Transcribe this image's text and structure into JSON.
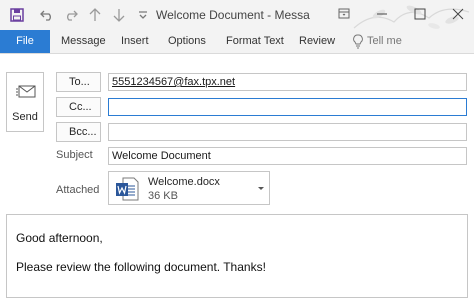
{
  "window": {
    "title": "Welcome Document  -  Messa"
  },
  "quick_access": {
    "icons": [
      "save-icon",
      "undo-icon",
      "redo-icon",
      "up-arrow-icon",
      "down-arrow-icon",
      "customize-icon"
    ]
  },
  "ribbon": {
    "tabs": [
      {
        "label": "File"
      },
      {
        "label": "Message"
      },
      {
        "label": "Insert"
      },
      {
        "label": "Options"
      },
      {
        "label": "Format Text"
      },
      {
        "label": "Review"
      }
    ],
    "tell_me": "Tell me"
  },
  "compose": {
    "send_label": "Send",
    "to_label": "To...",
    "cc_label": "Cc...",
    "bcc_label": "Bcc...",
    "to_value": "5551234567@fax.tpx.net",
    "cc_value": "",
    "bcc_value": "",
    "subject_label": "Subject",
    "subject_value": "Welcome Document",
    "attached_label": "Attached",
    "attachment": {
      "name": "Welcome.docx",
      "size": "36 KB"
    }
  },
  "body": {
    "line1": "Good afternoon,",
    "line2": "Please review the following document. Thanks!"
  },
  "colors": {
    "accent": "#2b7cd3",
    "word_blue": "#2b579a"
  }
}
